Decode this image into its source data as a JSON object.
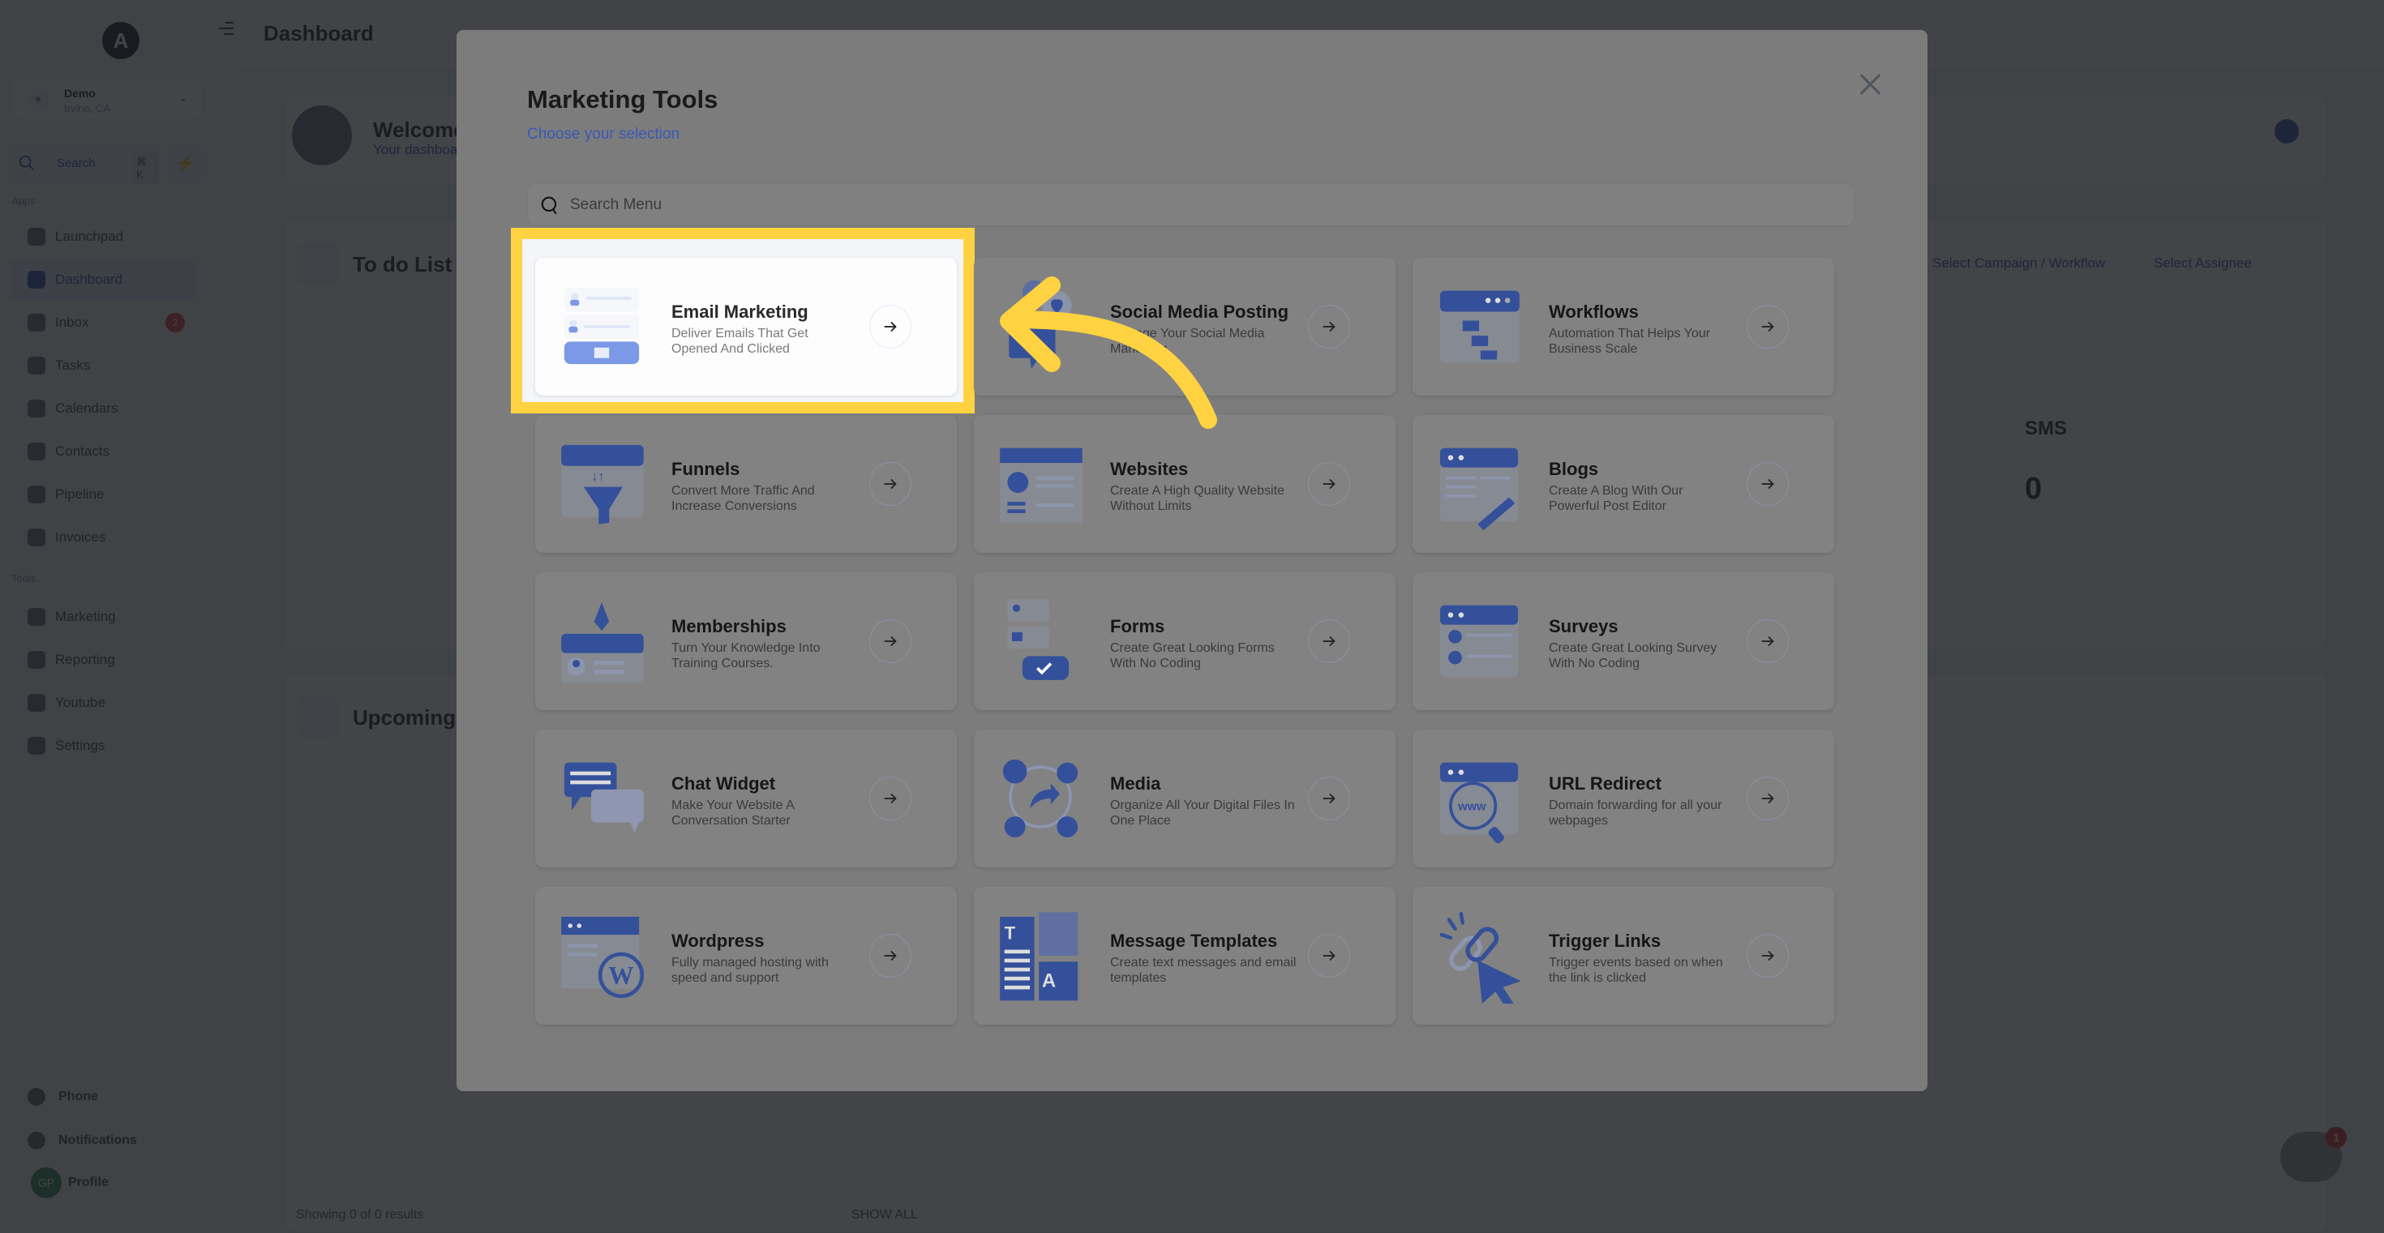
{
  "app": {
    "page_title": "Dashboard",
    "logo_letter": "A",
    "location": {
      "name": "Demo",
      "city": "Irvine, CA"
    },
    "search": {
      "label": "Search",
      "shortcut": "⌘ K"
    },
    "sections": {
      "apps": "Apps",
      "tools": "Tools"
    },
    "nav_apps": [
      {
        "label": "Launchpad",
        "icon": "launchpad-icon"
      },
      {
        "label": "Dashboard",
        "icon": "dashboard-icon",
        "active": true
      },
      {
        "label": "Inbox",
        "icon": "inbox-icon",
        "badge": "2"
      },
      {
        "label": "Tasks",
        "icon": "tasks-icon"
      },
      {
        "label": "Calendars",
        "icon": "calendar-icon"
      },
      {
        "label": "Contacts",
        "icon": "contacts-icon"
      },
      {
        "label": "Pipeline",
        "icon": "pipeline-icon"
      },
      {
        "label": "Invoices",
        "icon": "invoices-icon"
      }
    ],
    "nav_tools": [
      {
        "label": "Marketing",
        "icon": "megaphone-icon"
      },
      {
        "label": "Reporting",
        "icon": "pie-chart-icon"
      },
      {
        "label": "Youtube",
        "icon": "youtube-icon"
      },
      {
        "label": "Settings",
        "icon": "gear-icon"
      }
    ],
    "footer": {
      "phone": "Phone",
      "notifications": "Notifications",
      "profile": "Profile",
      "profile_initials": "GP"
    },
    "dashboard": {
      "welcome_title": "Welcome",
      "welcome_sub": "Your dashboard",
      "todo_title": "To do List",
      "upcoming_title": "Upcoming",
      "campaign_filter": "Select Campaign / Workflow",
      "assignee_filter": "Select Assignee",
      "sms_label": "SMS",
      "sms_value": "0",
      "results_text": "Showing 0 of 0 results",
      "show_all": "SHOW ALL",
      "chat_badge": "1"
    }
  },
  "modal": {
    "title": "Marketing Tools",
    "subtitle": "Choose your selection",
    "search_placeholder": "Search Menu",
    "search_value": "",
    "highlight_color": "#ffd242",
    "accent_color": "#3b57b5",
    "tools": [
      {
        "name": "Email Marketing",
        "desc": "Deliver Emails That Get Opened And Clicked",
        "icon": "email-marketing-illustration",
        "highlighted": true
      },
      {
        "name": "Social Media Posting",
        "desc": "Manage Your Social Media Marketing",
        "icon": "social-media-illustration"
      },
      {
        "name": "Workflows",
        "desc": "Automation That Helps Your Business Scale",
        "icon": "workflow-illustration"
      },
      {
        "name": "Funnels",
        "desc": "Convert More Traffic And Increase Conversions",
        "icon": "funnel-illustration"
      },
      {
        "name": "Websites",
        "desc": "Create A High Quality Website Without Limits",
        "icon": "website-illustration"
      },
      {
        "name": "Blogs",
        "desc": "Create A Blog With Our Powerful Post Editor",
        "icon": "blog-illustration"
      },
      {
        "name": "Memberships",
        "desc": "Turn Your Knowledge Into Training Courses.",
        "icon": "membership-illustration"
      },
      {
        "name": "Forms",
        "desc": "Create Great Looking Forms With No Coding",
        "icon": "forms-illustration"
      },
      {
        "name": "Surveys",
        "desc": "Create Great Looking Survey With No Coding",
        "icon": "surveys-illustration"
      },
      {
        "name": "Chat Widget",
        "desc": "Make Your Website A Conversation Starter",
        "icon": "chat-widget-illustration"
      },
      {
        "name": "Media",
        "desc": "Organize All Your Digital Files In One Place",
        "icon": "media-illustration"
      },
      {
        "name": "URL Redirect",
        "desc": "Domain forwarding for all your webpages",
        "icon": "url-redirect-illustration"
      },
      {
        "name": "Wordpress",
        "desc": "Fully managed hosting with speed and support",
        "icon": "wordpress-illustration"
      },
      {
        "name": "Message Templates",
        "desc": "Create text messages and email templates",
        "icon": "message-templates-illustration"
      },
      {
        "name": "Trigger Links",
        "desc": "Trigger events based on when the link is clicked",
        "icon": "trigger-links-illustration"
      }
    ]
  }
}
